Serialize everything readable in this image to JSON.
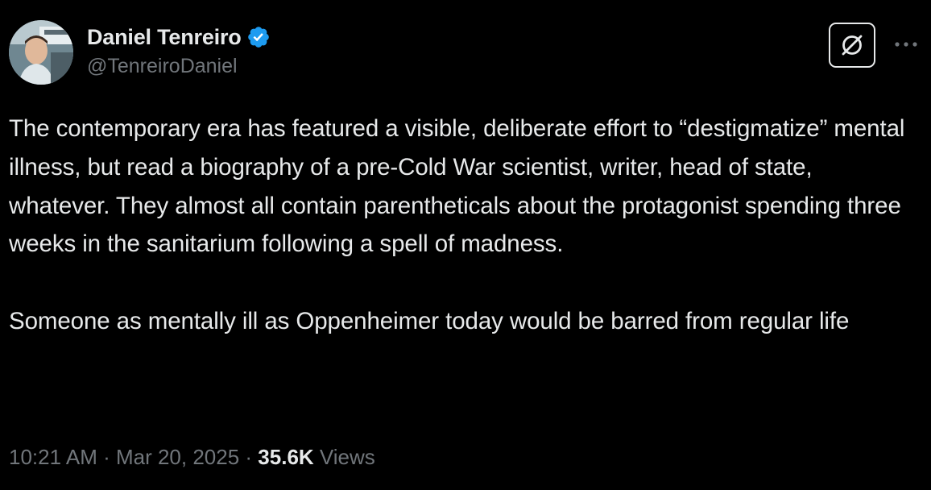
{
  "author": {
    "display_name": "Daniel Tenreiro",
    "handle": "@TenreiroDaniel",
    "verified": true,
    "verified_color": "#1d9bf0"
  },
  "actions": {
    "grok_icon": "grok-icon",
    "more_icon": "more-dots-icon"
  },
  "tweet": {
    "paragraphs": [
      "The contemporary era has featured a visible, deliberate effort to “destigmatize” mental illness, but read a biography of a pre-Cold War scientist, writer, head of state, whatever. They almost all contain parentheticals about the protagonist spending three weeks in the sanitarium following a spell of madness.",
      "Someone as mentally ill as Oppenheimer today would be barred from regular life"
    ]
  },
  "meta": {
    "time": "10:21 AM",
    "separator": " · ",
    "date": "Mar 20, 2025",
    "views_count": "35.6K",
    "views_label": " Views"
  },
  "colors": {
    "background": "#000000",
    "text_primary": "#e7e9ea",
    "text_secondary": "#71767b"
  }
}
